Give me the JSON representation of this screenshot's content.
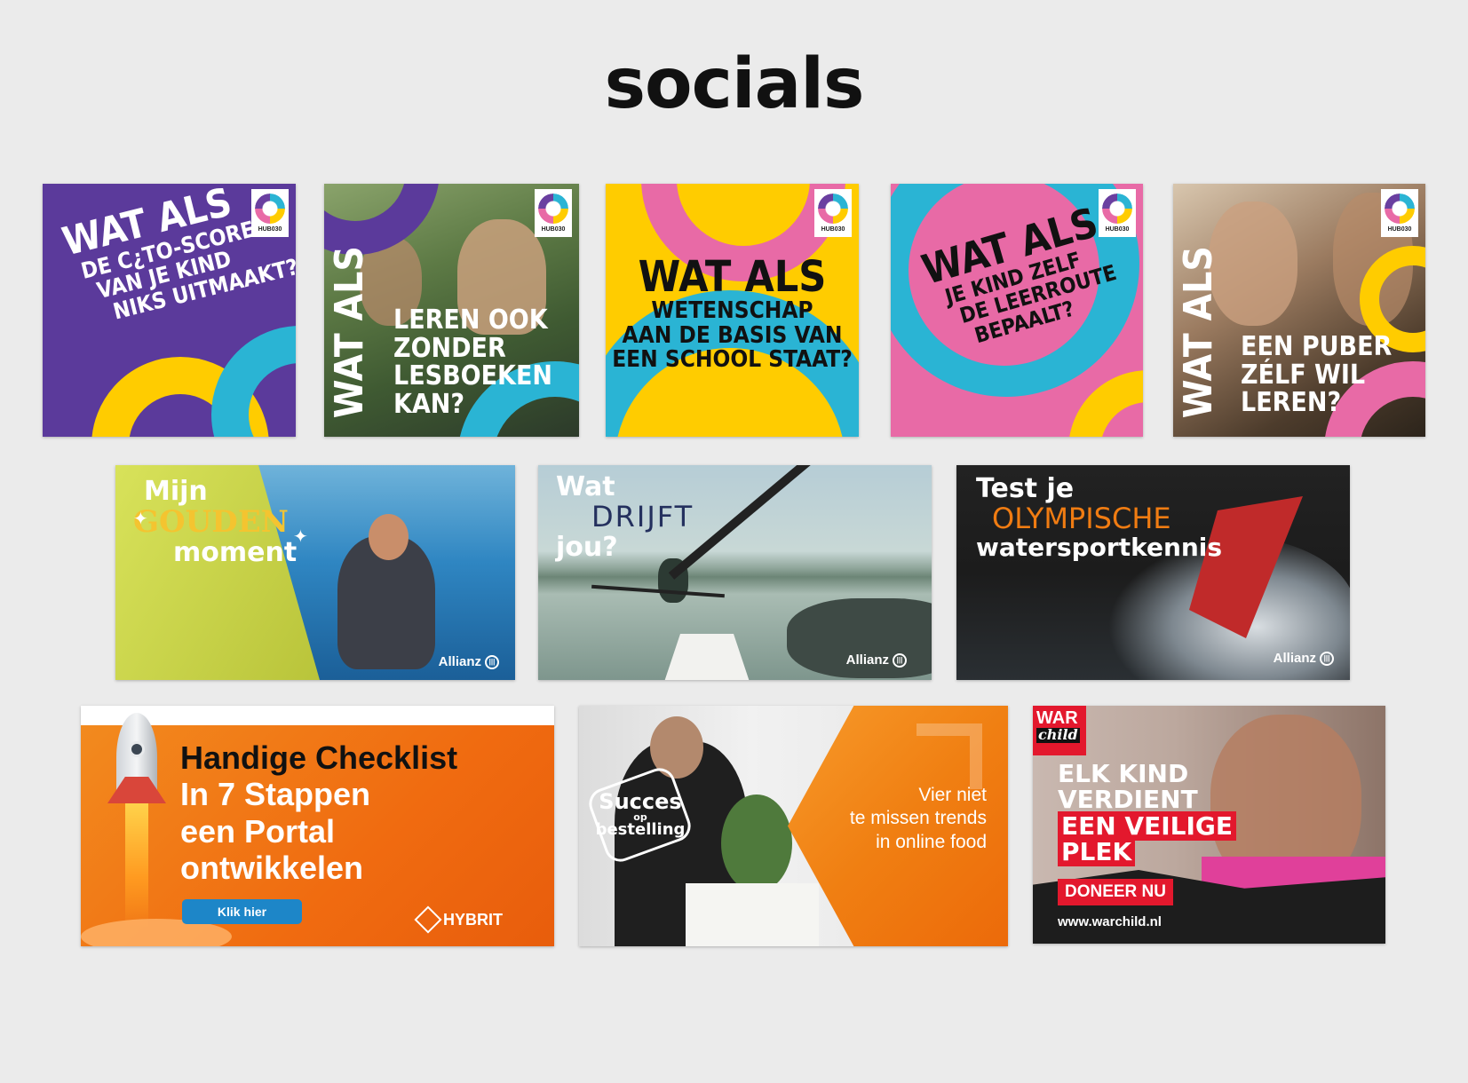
{
  "page": {
    "title": "socials"
  },
  "hub_logo": "HUB030",
  "row1": [
    {
      "lines": [
        "WAT ALS",
        "DE C¿TO-SCORE",
        "VAN JE KIND",
        "NIKS UITMAAKT?"
      ]
    },
    {
      "vertical": "WAT ALS",
      "lines": [
        "LEREN OOK",
        "ZONDER",
        "LESBOEKEN",
        "KAN?"
      ]
    },
    {
      "heading": "WAT ALS",
      "lines": [
        "WETENSCHAP",
        "AAN DE BASIS VAN",
        "EEN SCHOOL STAAT?"
      ]
    },
    {
      "heading": "WAT ALS",
      "lines": [
        "JE KIND ZELF",
        "DE LEERROUTE",
        "BEPAALT?"
      ]
    },
    {
      "vertical": "WAT ALS",
      "lines": [
        "EEN PUBER",
        "ZÉLF WIL",
        "LEREN?"
      ]
    }
  ],
  "row2": [
    {
      "line1": "Mijn",
      "highlight": "GOUDEN",
      "line3": "moment",
      "sponsor": "Allianz"
    },
    {
      "line1": "Wat",
      "highlight": "DRIJFT",
      "line3": "jou?",
      "sponsor": "Allianz"
    },
    {
      "line1": "Test je",
      "highlight": "OLYMPISCHE",
      "line3": "watersportkennis",
      "sponsor": "Allianz"
    }
  ],
  "hybrit": {
    "lines": [
      "Handige Checklist",
      "In 7 Stappen",
      "een Portal",
      "ontwikkelen"
    ],
    "button": "Klik hier",
    "brand": "HYBRIT"
  },
  "food": {
    "badge_top": "Succes",
    "badge_mid": "op",
    "badge_bottom": "bestelling",
    "lines": [
      "Vier niet",
      "te missen trends",
      "in online food"
    ]
  },
  "warchild": {
    "logo_top": "WAR",
    "logo_bottom": "child",
    "lines_white": [
      "ELK KIND",
      "VERDIENT"
    ],
    "lines_red": [
      "EEN VEILIGE",
      "PLEK"
    ],
    "button": "DONEER NU",
    "url": "www.warchild.nl"
  },
  "colors": {
    "purple": "#5b3a9b",
    "yellow": "#ffcc00",
    "cyan": "#2ab4d4",
    "pink": "#e86aa6",
    "orange": "#f07c12",
    "red": "#e3182d"
  }
}
